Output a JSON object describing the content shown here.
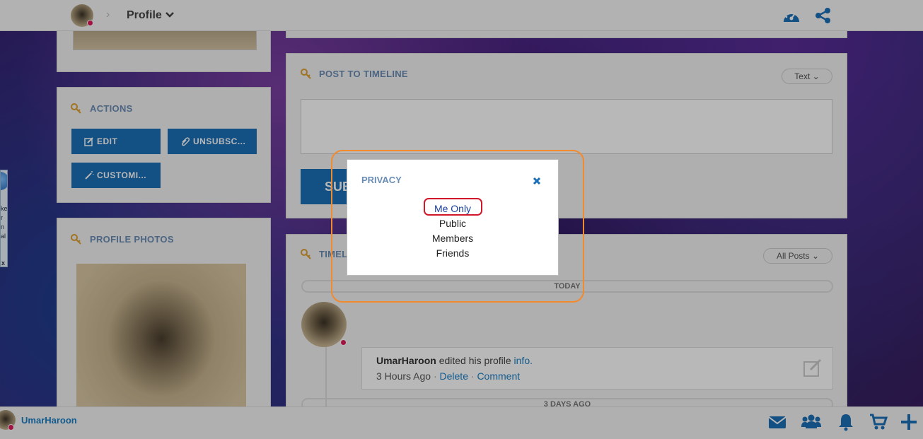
{
  "header": {
    "breadcrumb_label": "Profile"
  },
  "left": {
    "actions_title": "ACTIONS",
    "edit_label": "EDIT",
    "unsubscribe_label": "UNSUBSC...",
    "customize_label": "CUSTOMI...",
    "photos_title": "PROFILE PHOTOS"
  },
  "post": {
    "title": "POST TO TIMELINE",
    "type_select": "Text",
    "submit_partial": "SUB"
  },
  "timeline": {
    "title_partial": "TIMEL",
    "filter_select": "All Posts",
    "today_label": "TODAY",
    "three_days_label": "3 DAYS AGO",
    "entry": {
      "user": "UmarHaroon",
      "action_text": "edited his profile",
      "link_text": "info.",
      "time": "3 Hours Ago",
      "delete": "Delete",
      "comment": "Comment"
    }
  },
  "side_widget": {
    "text_lines": [
      "ke",
      "r",
      "n",
      "al"
    ],
    "close": "x"
  },
  "modal": {
    "title": "PRIVACY",
    "options": [
      "Me Only",
      "Public",
      "Members",
      "Friends"
    ],
    "selected_index": 0
  },
  "footer": {
    "username": "UmarHaroon"
  },
  "colors": {
    "accent": "#1b6fb8",
    "link": "#1a7fc5",
    "highlight_ring": "#f28a2e",
    "selected_ring": "#d0182a",
    "status": "#e0195a"
  }
}
